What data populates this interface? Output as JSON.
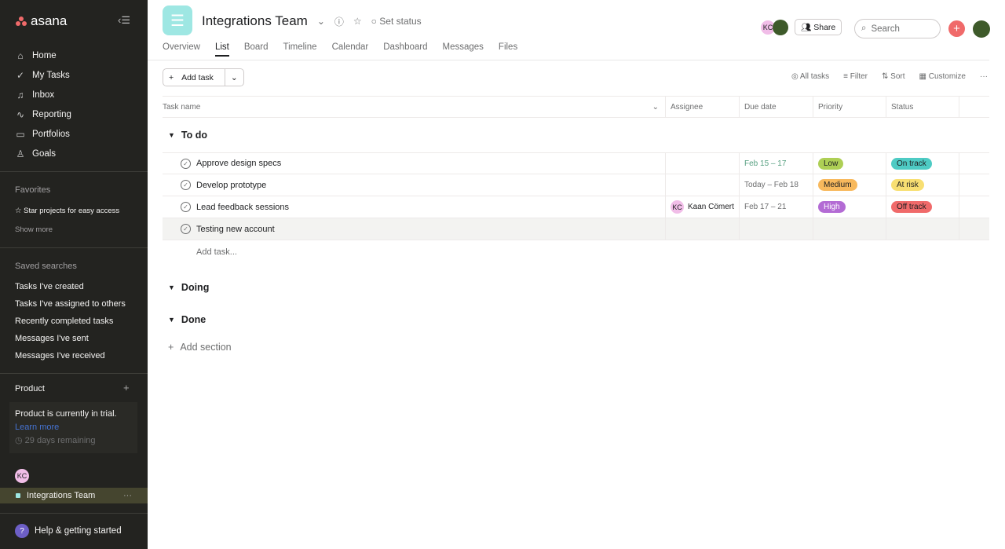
{
  "sidebar": {
    "logo": "asana",
    "nav": [
      {
        "label": "Home",
        "icon": "home-icon"
      },
      {
        "label": "My Tasks",
        "icon": "check-circle-icon"
      },
      {
        "label": "Inbox",
        "icon": "bell-icon"
      },
      {
        "label": "Reporting",
        "icon": "chart-icon"
      },
      {
        "label": "Portfolios",
        "icon": "folder-icon"
      },
      {
        "label": "Goals",
        "icon": "person-icon"
      }
    ],
    "favorites_title": "Favorites",
    "favorites_hint": "Star projects for easy access",
    "show_more": "Show more",
    "saved_title": "Saved searches",
    "saved": [
      "Tasks I've created",
      "Tasks I've assigned to others",
      "Recently completed tasks",
      "Messages I've sent",
      "Messages I've received"
    ],
    "team_title": "Product",
    "trial_text": "Product is currently in trial.",
    "learn_more": "Learn more",
    "days_remaining": "29 days remaining",
    "avatar": "KC",
    "project": "Integrations Team",
    "help": "Help & getting started"
  },
  "header": {
    "title": "Integrations Team",
    "set_status": "Set status",
    "share": "Share",
    "search_placeholder": "Search",
    "avatar": "KC",
    "tabs": [
      "Overview",
      "List",
      "Board",
      "Timeline",
      "Calendar",
      "Dashboard",
      "Messages",
      "Files"
    ],
    "active_tab": "List"
  },
  "toolbar": {
    "add_task": "Add task",
    "all_tasks": "All tasks",
    "filter": "Filter",
    "sort": "Sort",
    "customize": "Customize"
  },
  "columns": [
    "Task name",
    "Assignee",
    "Due date",
    "Priority",
    "Status"
  ],
  "sections": [
    {
      "name": "To do",
      "tasks": [
        {
          "name": "Approve design specs",
          "assignee": "",
          "assignee_initials": "",
          "due": "Feb 15 – 17",
          "priority": "Low",
          "priority_color": "#aecf55",
          "status": "On track",
          "status_color": "#4ecbc4"
        },
        {
          "name": "Develop prototype",
          "assignee": "",
          "assignee_initials": "",
          "due": "Today – Feb 18",
          "priority": "Medium",
          "priority_color": "#f8b95d",
          "status": "At risk",
          "status_color": "#f8df72"
        },
        {
          "name": "Lead feedback sessions",
          "assignee": "Kaan Cömert",
          "assignee_initials": "KC",
          "due": "Feb 17 – 21",
          "priority": "High",
          "priority_color": "#b36bd4",
          "status": "Off track",
          "status_color": "#f06a6a"
        },
        {
          "name": "Testing new account",
          "assignee": "",
          "assignee_initials": "",
          "due": "",
          "priority": "",
          "priority_color": "",
          "status": "",
          "status_color": ""
        }
      ],
      "add_task": "Add task..."
    },
    {
      "name": "Doing"
    },
    {
      "name": "Done"
    }
  ],
  "add_section": "Add section"
}
